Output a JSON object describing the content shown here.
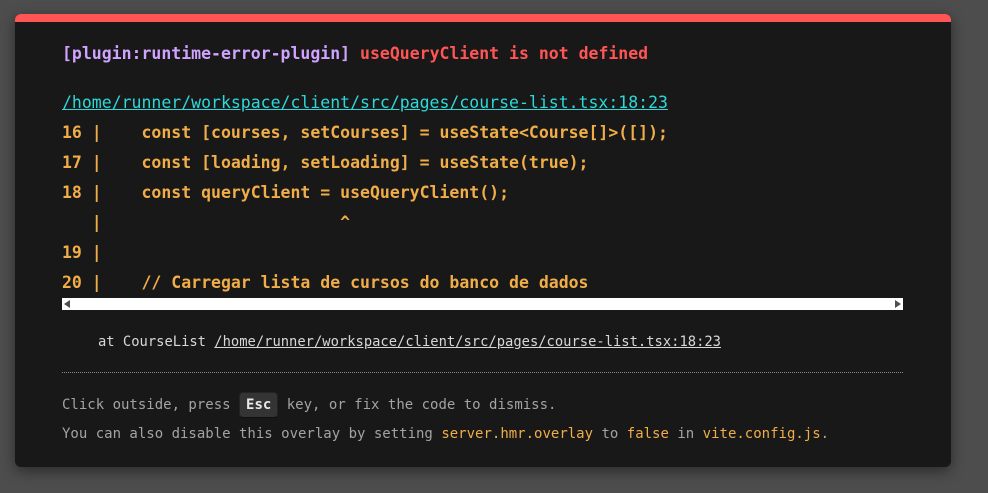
{
  "overlay": {
    "accent_color": "#ff5555",
    "plugin_label": "[plugin:runtime-error-plugin]",
    "error_message": "useQueryClient is not defined",
    "file_location": "/home/runner/workspace/client/src/pages/course-list.tsx:18:23",
    "code_frame": [
      "16 |    const [courses, setCourses] = useState<Course[]>([]);",
      "17 |    const [loading, setLoading] = useState(true);",
      "18 |    const queryClient = useQueryClient();",
      "   |                        ^",
      "19 |",
      "20 |    // Carregar lista de cursos do banco de dados"
    ],
    "stack": {
      "prefix": "at CourseList",
      "file": "/home/runner/workspace/client/src/pages/course-list.tsx:18:23"
    },
    "tip_line1": {
      "before": "Click outside, press",
      "key": "Esc",
      "after": "key, or fix the code to dismiss."
    },
    "tip_line2": {
      "before": "You can also disable this overlay by setting",
      "setting": "server.hmr.overlay",
      "to": "to",
      "value": "false",
      "in": "in",
      "file": "vite.config.js",
      "end": "."
    }
  }
}
